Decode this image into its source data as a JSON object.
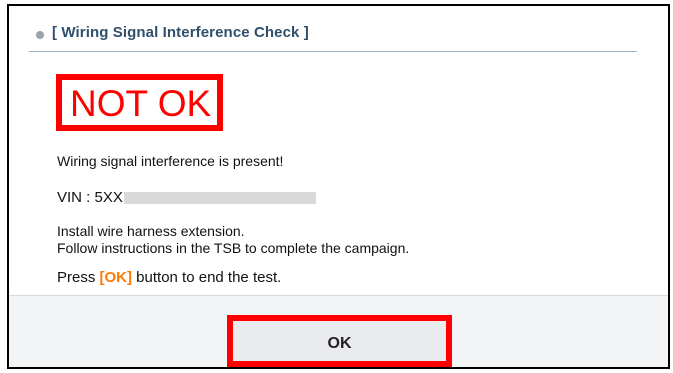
{
  "dialog": {
    "title": "[ Wiring Signal Interference Check ]",
    "status": "NOT OK",
    "status_color": "#ff0000",
    "message": "Wiring signal interference is present!",
    "vin_label": "VIN : 5XX",
    "instructions": [
      "Install wire harness extension.",
      "Follow instructions in the TSB to complete the campaign."
    ],
    "press": {
      "prefix": "Press ",
      "button_ref": "[OK]",
      "suffix": " button to end the test."
    },
    "ok_button_label": "OK",
    "accent_color": "#ff7a00"
  }
}
